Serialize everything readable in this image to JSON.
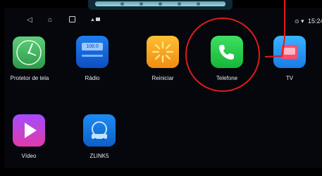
{
  "statusbar": {
    "time": "15:24",
    "icons": [
      "back-icon",
      "home-icon",
      "recent-apps-icon",
      "warning-icon",
      "image-icon",
      "location-icon",
      "wifi-icon"
    ]
  },
  "apps": [
    {
      "label": "Protetor de tela",
      "icon": "clock-face-icon"
    },
    {
      "label": "Rádio",
      "icon": "radio-icon",
      "display": "108.0"
    },
    {
      "label": "Reiniciar",
      "icon": "reboot-sunburst-icon"
    },
    {
      "label": "Telefone",
      "icon": "phone-icon"
    },
    {
      "label": "TV",
      "icon": "tv-icon"
    },
    {
      "label": "Vídeo",
      "icon": "video-play-icon"
    },
    {
      "label": "ZLINK5",
      "icon": "zlink-car-icon"
    }
  ],
  "colors": {
    "highlight": "#e01b1b",
    "phone_green": "#22c445",
    "background": "#05070c"
  }
}
